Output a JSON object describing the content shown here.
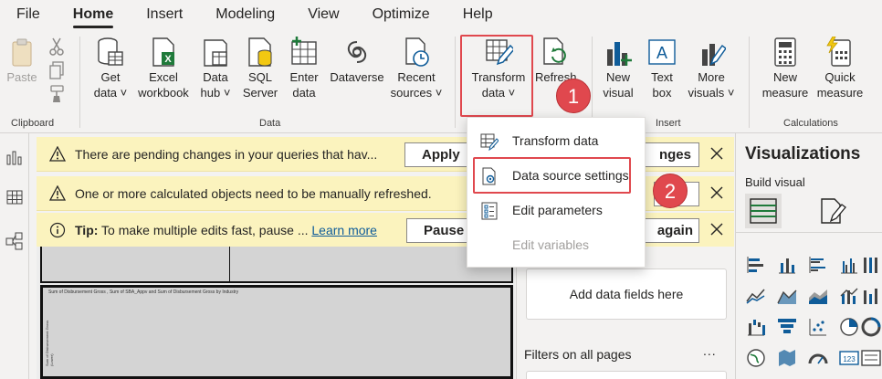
{
  "menu": {
    "items": [
      "File",
      "Home",
      "Insert",
      "Modeling",
      "View",
      "Optimize",
      "Help"
    ],
    "active": "Home"
  },
  "ribbon": {
    "clipboard": {
      "paste": "Paste",
      "group_label": "Clipboard"
    },
    "data": {
      "get_data": [
        "Get",
        "data ˅"
      ],
      "excel": [
        "Excel",
        "workbook"
      ],
      "data_hub": [
        "Data",
        "hub ˅"
      ],
      "sql": [
        "SQL",
        "Server"
      ],
      "enter": [
        "Enter",
        "data"
      ],
      "dataverse": "Dataverse",
      "recent": [
        "Recent",
        "sources ˅"
      ],
      "group_label": "Data"
    },
    "queries": {
      "transform": [
        "Transform",
        "data ˅"
      ],
      "refresh": "Refresh"
    },
    "insert": {
      "new_visual": [
        "New",
        "visual"
      ],
      "text_box": [
        "Text",
        "box"
      ],
      "more_visuals": [
        "More",
        "visuals ˅"
      ],
      "group_label": "Insert"
    },
    "calculations": {
      "new_measure": [
        "New",
        "measure"
      ],
      "quick_measure": [
        "Quick",
        "measure"
      ],
      "group_label": "Calculations"
    }
  },
  "notifications": [
    {
      "text": "There are pending changes in your queries that hav...",
      "button": "Apply",
      "button_tail": "nges"
    },
    {
      "text": "One or more calculated objects need to be manually refreshed.",
      "button": "",
      "button_tail": ""
    },
    {
      "tip_label": "Tip:",
      "text": " To make multiple edits fast, pause ...",
      "link": "Learn more",
      "button": "Pause",
      "button_tail": "again"
    }
  ],
  "dropdown": {
    "items": [
      {
        "label": "Transform data",
        "enabled": true
      },
      {
        "label": "Data source settings",
        "enabled": true
      },
      {
        "label": "Edit parameters",
        "enabled": true
      },
      {
        "label": "Edit variables",
        "enabled": false
      }
    ]
  },
  "badges": {
    "step1": "1",
    "step2": "2"
  },
  "canvas": {
    "visual_title": "Sum of Disbursement Gross , Sum of SBA_Appv and Sum of Disbursement Gross by Industry",
    "visual_axis": "Sum of Disbursement Gross (Lower)"
  },
  "filters": {
    "add_fields": "Add data fields here",
    "filters_all_pages": "Filters on all pages",
    "more": "..."
  },
  "visualizations": {
    "title": "Visualizations",
    "build_visual": "Build visual"
  },
  "colors": {
    "highlight": "#e0484e",
    "notification_bg": "#fbf3be",
    "accent_yellow": "#f2c811",
    "accent_green": "#1f7a3a",
    "accent_blue": "#0f5c99"
  }
}
